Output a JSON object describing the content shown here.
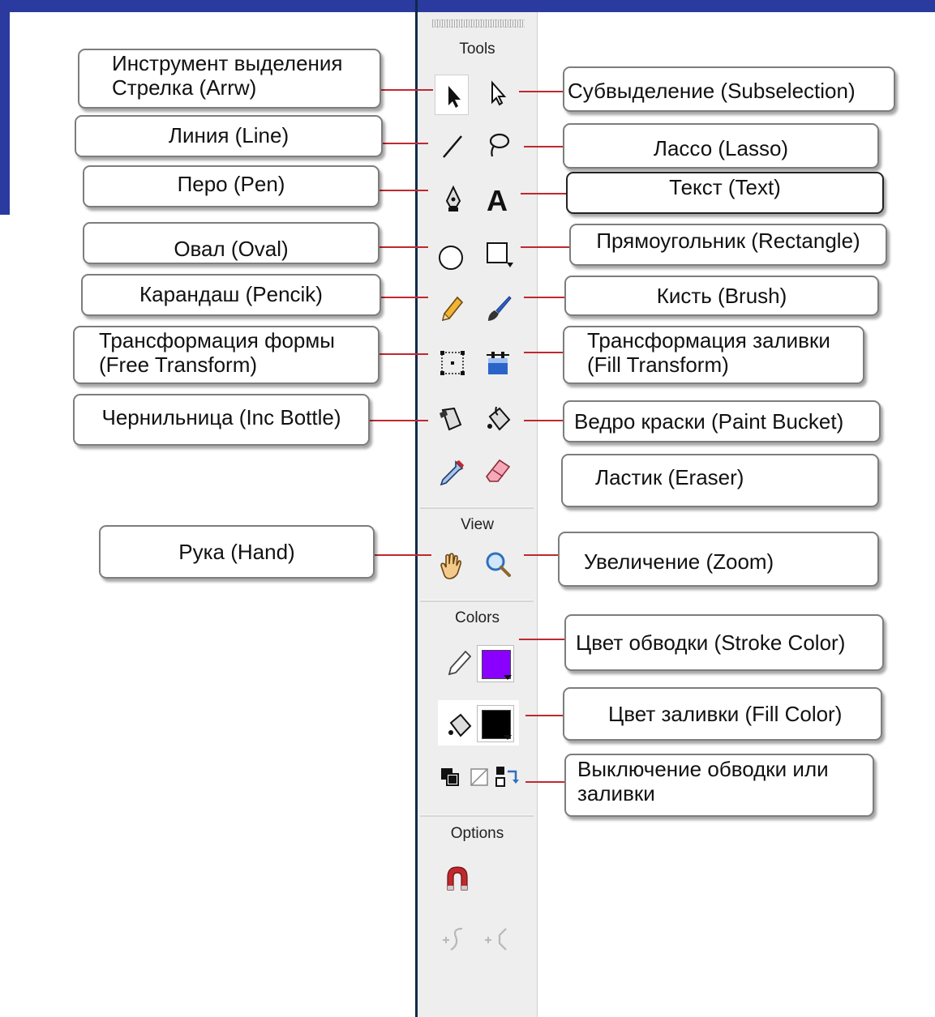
{
  "panel": {
    "sections": {
      "tools": "Tools",
      "view": "View",
      "colors": "Colors",
      "options": "Options"
    },
    "colors": {
      "stroke_color": "#8a00ff",
      "fill_color": "#000000"
    },
    "icons": {
      "row1": [
        "arrow-icon",
        "subselection-icon"
      ],
      "row2": [
        "line-icon",
        "lasso-icon"
      ],
      "row3": [
        "pen-icon",
        "text-icon"
      ],
      "row4": [
        "oval-icon",
        "rectangle-icon"
      ],
      "row5": [
        "pencil-icon",
        "brush-icon"
      ],
      "row6": [
        "free-transform-icon",
        "fill-transform-icon"
      ],
      "row7": [
        "ink-bottle-icon",
        "paint-bucket-icon"
      ],
      "row8": [
        "eyedropper-icon",
        "eraser-icon"
      ],
      "view": [
        "hand-icon",
        "zoom-icon"
      ],
      "colors": [
        "stroke-pencil-icon",
        "stroke-color-swatch",
        "fill-bucket-icon",
        "fill-color-swatch",
        "black-white-icon",
        "no-color-icon",
        "swap-colors-icon"
      ],
      "options": [
        "snap-magnet-icon",
        "smooth-icon",
        "straighten-icon"
      ]
    }
  },
  "labels": {
    "arrow": [
      "Инструмент выделения",
      "Стрелка  (Arrw)"
    ],
    "subselection": "Субвыделение (Subselection)",
    "line": "Линия (Line)",
    "lasso": "Лассо (Lasso)",
    "pen": "Перо (Pen)",
    "text": "Текст (Text)",
    "oval": "Овал (Oval)",
    "rectangle": "Прямоугольник (Rectangle)",
    "pencil": "Карандаш (Pencik)",
    "brush": "Кисть (Brush)",
    "free_transform": [
      "Трансформация формы",
      "(Free Transform)"
    ],
    "fill_transform": [
      "Трансформация заливки",
      "(Fill Transform)"
    ],
    "ink_bottle": "Чернильница (Inc Bottle)",
    "paint_bucket": "Ведро краски (Paint Bucket)",
    "eraser": "Ластик (Eraser)",
    "hand": "Рука (Hand)",
    "zoom": "Увеличение (Zoom)",
    "stroke_color": "Цвет обводки (Stroke Color)",
    "fill_color": "Цвет заливки (Fill Color)",
    "no_color": [
      "Выключение обводки или",
      "заливки"
    ]
  }
}
